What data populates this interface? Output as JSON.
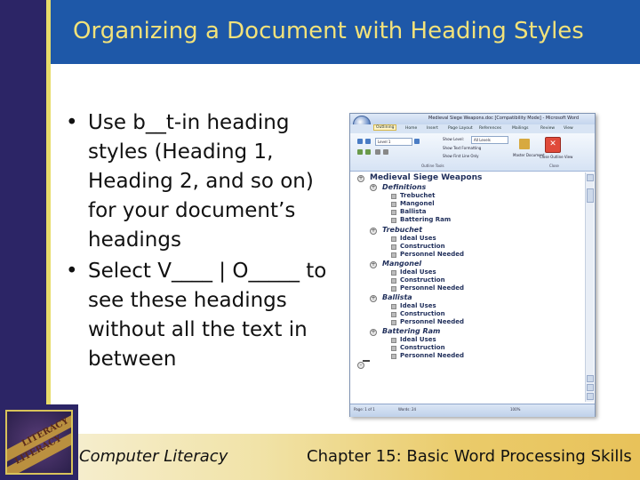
{
  "slide": {
    "title": "Organizing a Document with Heading Styles",
    "bullets": [
      "Use b__t-in heading styles (Heading 1, Heading 2, and so on) for your document’s headings",
      "Select V____ | O_____ to see these headings without all the text in between"
    ],
    "bullet_glyph": "•"
  },
  "colors": {
    "left_stripe": "#2c2566",
    "title_bar": "#1e58a8",
    "title_text": "#f2e27a",
    "footer_gold": "#eacb6a"
  },
  "word_window": {
    "title": "Medieval Siege Weapons.doc [Compatibility Mode] - Microsoft Word",
    "tabs": [
      "Outlining",
      "Home",
      "Insert",
      "Page Layout",
      "References",
      "Mailings",
      "Review",
      "View"
    ],
    "active_tab": "Outlining",
    "ribbon": {
      "level_select": "Level 1",
      "show_level_label": "Show Level:",
      "show_level_value": "All Levels",
      "show_text_formatting": "Show Text Formatting",
      "show_first_line_only": "Show First Line Only",
      "group_outline_tools": "Outline Tools",
      "master_document": "Master Document",
      "close_outline_view": "Close Outline View",
      "group_close": "Close"
    },
    "outline": [
      {
        "level": 1,
        "text": "Medieval Siege Weapons"
      },
      {
        "level": 2,
        "text": "Definitions"
      },
      {
        "level": 3,
        "text": "Trebuchet"
      },
      {
        "level": 3,
        "text": "Mangonel"
      },
      {
        "level": 3,
        "text": "Ballista"
      },
      {
        "level": 3,
        "text": "Battering Ram"
      },
      {
        "level": 2,
        "text": "Trebuchet"
      },
      {
        "level": 3,
        "text": "Ideal Uses"
      },
      {
        "level": 3,
        "text": "Construction"
      },
      {
        "level": 3,
        "text": "Personnel Needed"
      },
      {
        "level": 2,
        "text": "Mangonel"
      },
      {
        "level": 3,
        "text": "Ideal Uses"
      },
      {
        "level": 3,
        "text": "Construction"
      },
      {
        "level": 3,
        "text": "Personnel Needed"
      },
      {
        "level": 2,
        "text": "Ballista"
      },
      {
        "level": 3,
        "text": "Ideal Uses"
      },
      {
        "level": 3,
        "text": "Construction"
      },
      {
        "level": 3,
        "text": "Personnel Needed"
      },
      {
        "level": 2,
        "text": "Battering Ram"
      },
      {
        "level": 3,
        "text": "Ideal Uses"
      },
      {
        "level": 3,
        "text": "Construction"
      },
      {
        "level": 3,
        "text": "Personnel Needed"
      }
    ],
    "status": {
      "page": "Page: 1 of 1",
      "words": "Words: 24",
      "zoom": "100%"
    }
  },
  "footer": {
    "left": "Computer Literacy",
    "right": "Chapter 15: Basic Word Processing Skills"
  },
  "logo": {
    "text_top": "LITERACY",
    "text_bottom": "LITERACY"
  }
}
